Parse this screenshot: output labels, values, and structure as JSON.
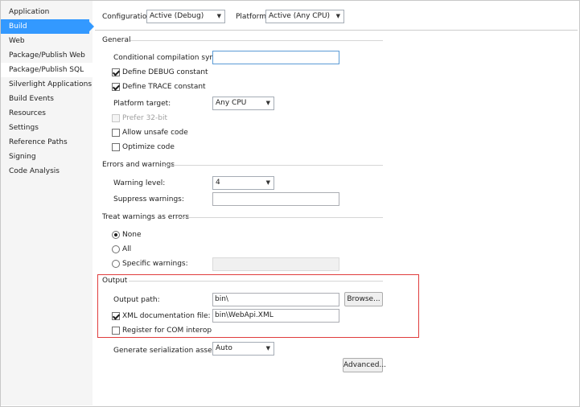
{
  "sidebar": {
    "items": [
      {
        "label": "Application"
      },
      {
        "label": "Build"
      },
      {
        "label": "Web"
      },
      {
        "label": "Package/Publish Web"
      },
      {
        "label": "Package/Publish SQL"
      },
      {
        "label": "Silverlight Applications"
      },
      {
        "label": "Build Events"
      },
      {
        "label": "Resources"
      },
      {
        "label": "Settings"
      },
      {
        "label": "Reference Paths"
      },
      {
        "label": "Signing"
      },
      {
        "label": "Code Analysis"
      }
    ]
  },
  "toolbar": {
    "configuration_label": "Configuration:",
    "configuration_value": "Active (Debug)",
    "platform_label": "Platform:",
    "platform_value": "Active (Any CPU)"
  },
  "general": {
    "title": "General",
    "conditional_symbols_label": "Conditional compilation symbols:",
    "conditional_symbols_value": "",
    "define_debug_label": "Define DEBUG constant",
    "define_debug_checked": true,
    "define_trace_label": "Define TRACE constant",
    "define_trace_checked": true,
    "platform_target_label": "Platform target:",
    "platform_target_value": "Any CPU",
    "prefer32_label": "Prefer 32-bit",
    "prefer32_checked": false,
    "allow_unsafe_label": "Allow unsafe code",
    "allow_unsafe_checked": false,
    "optimize_label": "Optimize code",
    "optimize_checked": false
  },
  "errors": {
    "title": "Errors and warnings",
    "warning_level_label": "Warning level:",
    "warning_level_value": "4",
    "suppress_label": "Suppress warnings:",
    "suppress_value": ""
  },
  "treat_warnings": {
    "title": "Treat warnings as errors",
    "none_label": "None",
    "all_label": "All",
    "specific_label": "Specific warnings:",
    "specific_value": "",
    "selected": "None"
  },
  "output": {
    "title": "Output",
    "output_path_label": "Output path:",
    "output_path_value": "bin\\",
    "browse_label": "Browse...",
    "xml_doc_label": "XML documentation file:",
    "xml_doc_checked": true,
    "xml_doc_value": "bin\\WebApi.XML",
    "com_interop_label": "Register for COM interop",
    "com_interop_checked": false,
    "serialization_label": "Generate serialization assembly:",
    "serialization_value": "Auto",
    "advanced_label": "Advanced..."
  },
  "colors": {
    "selected_bg": "#3399ff",
    "highlight_box": "#e03c3c"
  }
}
